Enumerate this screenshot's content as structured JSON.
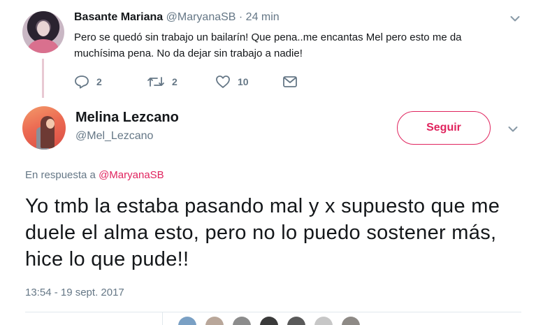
{
  "parent_tweet": {
    "author_name": "Basante Mariana",
    "meta": "@MaryanaSB · 24 min",
    "text": "Pero se quedó sin trabajo un bailarín! Que pena..me encantas Mel pero esto me da muchísima pena. No da dejar sin trabajo a nadie!",
    "reply_count": "2",
    "retweet_count": "2",
    "like_count": "10",
    "icons": [
      "reply-icon",
      "retweet-icon",
      "heart-icon",
      "direct-message-icon",
      "chevron-down-icon"
    ]
  },
  "main_tweet": {
    "author_name": "Melina Lezcano",
    "handle": "@Mel_Lezcano",
    "follow_label": "Seguir",
    "replying_prefix": "En respuesta a ",
    "replying_to": "@MaryanaSB",
    "text": "Yo tmb la estaba pasando mal y x supuesto que me duele el alma esto, pero no lo puedo sostener más, hice lo que pude!!",
    "timestamp": "13:54 - 19 sept. 2017"
  },
  "colors": {
    "accent": "#e0245e",
    "secondary_text": "#657786",
    "primary_text": "#14171a",
    "thread_line": "#e8c9d3",
    "divider": "#e1e8ed"
  }
}
